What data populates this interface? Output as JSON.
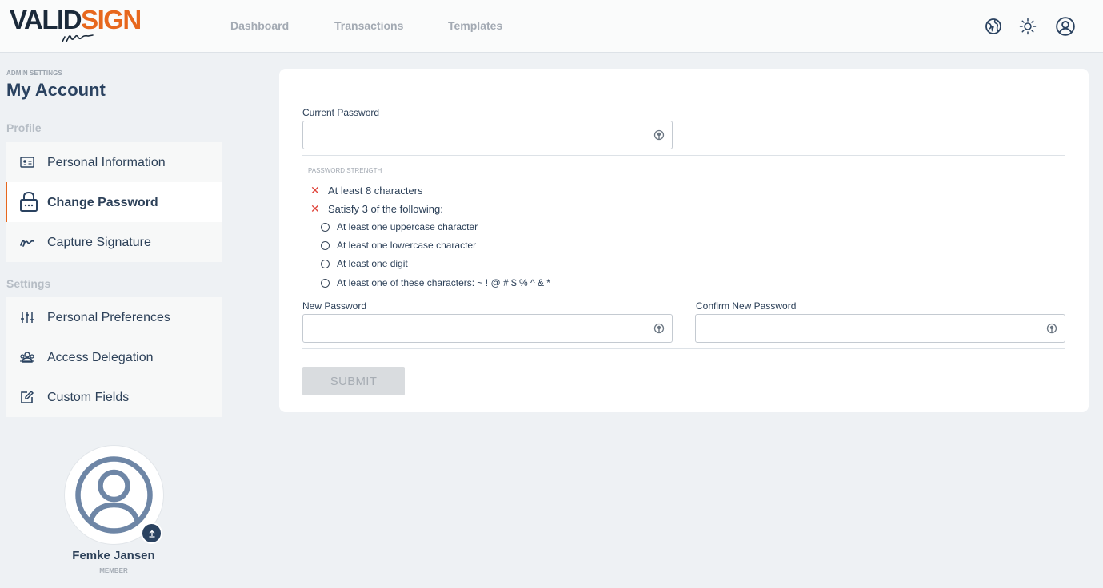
{
  "header": {
    "logo": {
      "part1": "VALID",
      "part2": "SIGN"
    },
    "nav": [
      "Dashboard",
      "Transactions",
      "Templates"
    ],
    "icons": [
      "globe-icon",
      "sun-icon",
      "user-circle-icon"
    ]
  },
  "sidebar": {
    "admin_label": "ADMIN SETTINGS",
    "title": "My Account",
    "profile_section": "Profile",
    "profile_items": [
      {
        "label": "Personal Information",
        "icon": "id-card-icon"
      },
      {
        "label": "Change Password",
        "icon": "lock-icon",
        "active": true
      },
      {
        "label": "Capture Signature",
        "icon": "signature-icon"
      }
    ],
    "settings_section": "Settings",
    "settings_items": [
      {
        "label": "Personal Preferences",
        "icon": "sliders-icon"
      },
      {
        "label": "Access Delegation",
        "icon": "users-icon"
      },
      {
        "label": "Custom Fields",
        "icon": "edit-icon"
      }
    ],
    "user": {
      "name": "Femke Jansen",
      "role": "MEMBER"
    }
  },
  "form": {
    "current_password_label": "Current Password",
    "current_password_value": "",
    "strength_label": "PASSWORD STRENGTH",
    "rules": [
      "At least 8 characters",
      "Satisfy 3 of the following:"
    ],
    "sub_rules": [
      "At least one uppercase character",
      "At least one lowercase character",
      "At least one digit",
      "At least one of these characters: ~ ! @ # $ % ^ & *"
    ],
    "new_password_label": "New Password",
    "new_password_value": "",
    "confirm_password_label": "Confirm New Password",
    "confirm_password_value": "",
    "submit_label": "SUBMIT"
  },
  "colors": {
    "accent": "#e7671d",
    "navy": "#2a4260",
    "error": "#e0443b",
    "background": "#eef1f4"
  }
}
